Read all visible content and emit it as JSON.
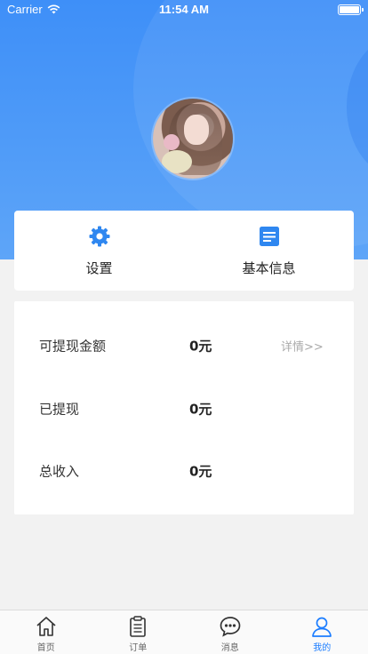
{
  "status_bar": {
    "carrier": "Carrier",
    "time": "11:54 AM"
  },
  "menu": [
    {
      "label": "设置",
      "icon": "gear-icon"
    },
    {
      "label": "基本信息",
      "icon": "document-icon"
    }
  ],
  "earnings": {
    "rows": [
      {
        "label": "可提现金额",
        "value": "0元",
        "link": "详情>>"
      },
      {
        "label": "已提现",
        "value": "0元"
      },
      {
        "label": "总收入",
        "value": "0元"
      }
    ]
  },
  "tabbar": {
    "items": [
      {
        "label": "首页",
        "icon": "home-icon"
      },
      {
        "label": "订单",
        "icon": "clipboard-icon"
      },
      {
        "label": "消息",
        "icon": "chat-icon"
      },
      {
        "label": "我的",
        "icon": "user-icon"
      }
    ],
    "active_index": 3
  },
  "colors": {
    "accent": "#1c7dff",
    "header_blue": "#4a96f8",
    "link_gray": "#a9a9a9"
  }
}
